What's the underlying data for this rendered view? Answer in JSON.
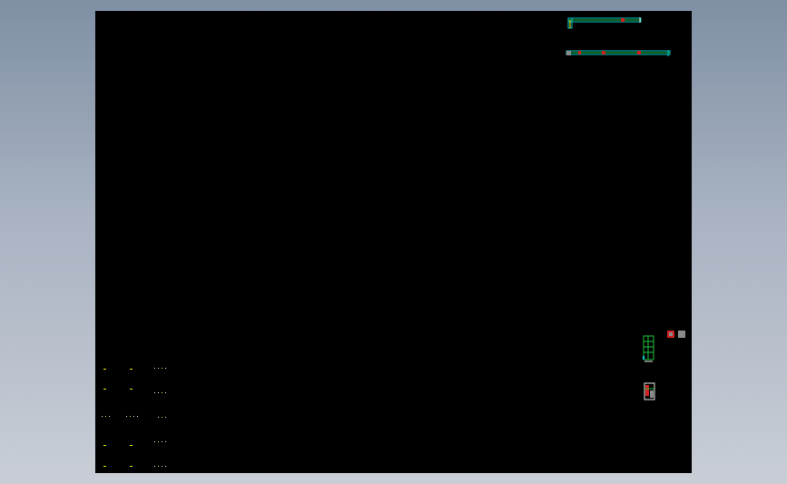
{
  "canvas": {
    "background": "#000000",
    "surround_gradient": [
      "#7f8fa4",
      "#c9ced6"
    ]
  },
  "colors": {
    "cyan": "#00c8c8",
    "green": "#20c040",
    "yellow": "#f0f000",
    "red": "#d02020",
    "grey": "#8a8a8a",
    "white": "#e8e8e8"
  },
  "objects": {
    "top_strip": "cad-drawing-strip",
    "lower_strip": "cad-drawing-strip",
    "cabinet": "cad-cabinet-elevation",
    "small_parts": "cad-detail-parts"
  }
}
